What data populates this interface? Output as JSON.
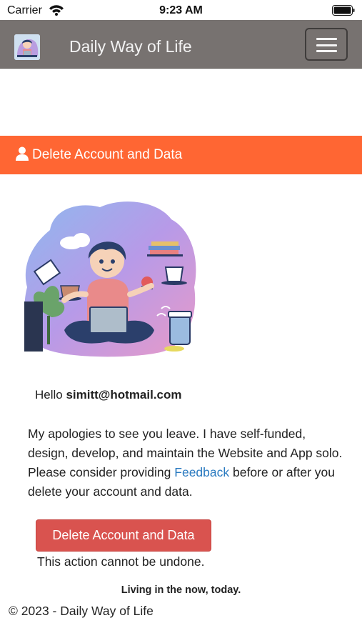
{
  "status_bar": {
    "carrier": "Carrier",
    "time": "9:23 AM"
  },
  "navbar": {
    "brand_title": "Daily Way of Life",
    "bg_color": "#777270"
  },
  "page_header": {
    "title": "Delete Account and Data",
    "icon": "user-icon",
    "bg_color": "#ff6633"
  },
  "content": {
    "greeting_prefix": "Hello ",
    "email": "simitt@hotmail.com",
    "message_before_link": "My apologies to see you leave. I have self-funded, design, develop, and maintain the Website and App solo. Please consider providing ",
    "feedback_link": "Feedback",
    "message_after_link": " before or after you delete your account and data.",
    "delete_button_label": "Delete Account and Data",
    "warning": "This action cannot be undone."
  },
  "footer": {
    "tagline": "Living in the now, today.",
    "copyright": "© 2023 - Daily Way of Life"
  },
  "colors": {
    "danger": "#d9534f",
    "link": "#2a7ac0"
  }
}
